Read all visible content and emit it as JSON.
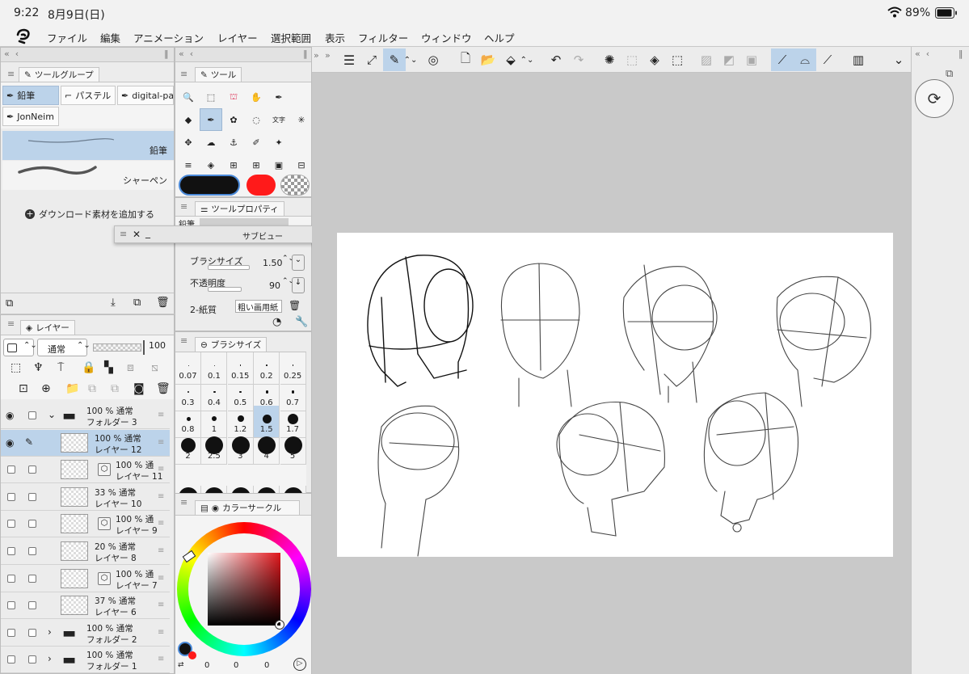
{
  "status": {
    "time": "9:22",
    "date": "8月9日(日)",
    "battery": "89%"
  },
  "menu": [
    "ファイル",
    "編集",
    "アニメーション",
    "レイヤー",
    "選択範囲",
    "表示",
    "フィルター",
    "ウィンドウ",
    "ヘルプ"
  ],
  "toolgroup": {
    "tab": "ツールグループ",
    "items": [
      "鉛筆",
      "パステル",
      "digital-pa",
      "JonNeim"
    ],
    "brushes": [
      {
        "label": "鉛筆"
      },
      {
        "label": "シャーペン"
      }
    ],
    "add_download": "ダウンロード素材を追加する"
  },
  "tools": {
    "tab": "ツール"
  },
  "toolprops": {
    "tab": "ツールプロパティ",
    "brush_name": "鉛筆",
    "brush_size_label": "ブラシサイズ",
    "brush_size_value": "1.50",
    "opacity_label": "不透明度",
    "opacity_value": "90",
    "paper_label": "2-紙質",
    "paper_value": "粗い画用紙"
  },
  "subview": {
    "title": "サブビュー"
  },
  "brushsize": {
    "tab": "ブラシサイズ",
    "sizes": [
      "0.07",
      "0.1",
      "0.15",
      "0.2",
      "0.25",
      "0.3",
      "0.4",
      "0.5",
      "0.6",
      "0.7",
      "0.8",
      "1",
      "1.2",
      "1.5",
      "1.7",
      "2",
      "2.5",
      "3",
      "4",
      "5"
    ],
    "selected": "1.5"
  },
  "colorcircle": {
    "tab": "カラーサークル",
    "vals": [
      "0",
      "0",
      "0"
    ]
  },
  "layers": {
    "tab": "レイヤー",
    "blend_mode": "通常",
    "opacity": "100",
    "items": [
      {
        "pct": "100 %",
        "mode": "通常",
        "name": "フォルダー 3",
        "type": "folder"
      },
      {
        "pct": "100 %",
        "mode": "通常",
        "name": "レイヤー 12",
        "type": "layer"
      },
      {
        "pct": "100 %",
        "mode": "通",
        "name": "レイヤー 11",
        "type": "sublayer"
      },
      {
        "pct": "33 %",
        "mode": "通常",
        "name": "レイヤー 10",
        "type": "layer"
      },
      {
        "pct": "100 %",
        "mode": "通",
        "name": "レイヤー 9",
        "type": "sublayer"
      },
      {
        "pct": "20 %",
        "mode": "通常",
        "name": "レイヤー 8",
        "type": "layer"
      },
      {
        "pct": "100 %",
        "mode": "通",
        "name": "レイヤー 7",
        "type": "sublayer"
      },
      {
        "pct": "37 %",
        "mode": "通常",
        "name": "レイヤー 6",
        "type": "layer"
      },
      {
        "pct": "100 %",
        "mode": "通常",
        "name": "フォルダー 2",
        "type": "folder"
      },
      {
        "pct": "100 %",
        "mode": "通常",
        "name": "フォルダー 1",
        "type": "folder"
      }
    ]
  },
  "colors": {
    "accent": "#4a89d8",
    "selected": "#bcd3ea",
    "main": "#111111",
    "sub": "#ff1a1a"
  }
}
